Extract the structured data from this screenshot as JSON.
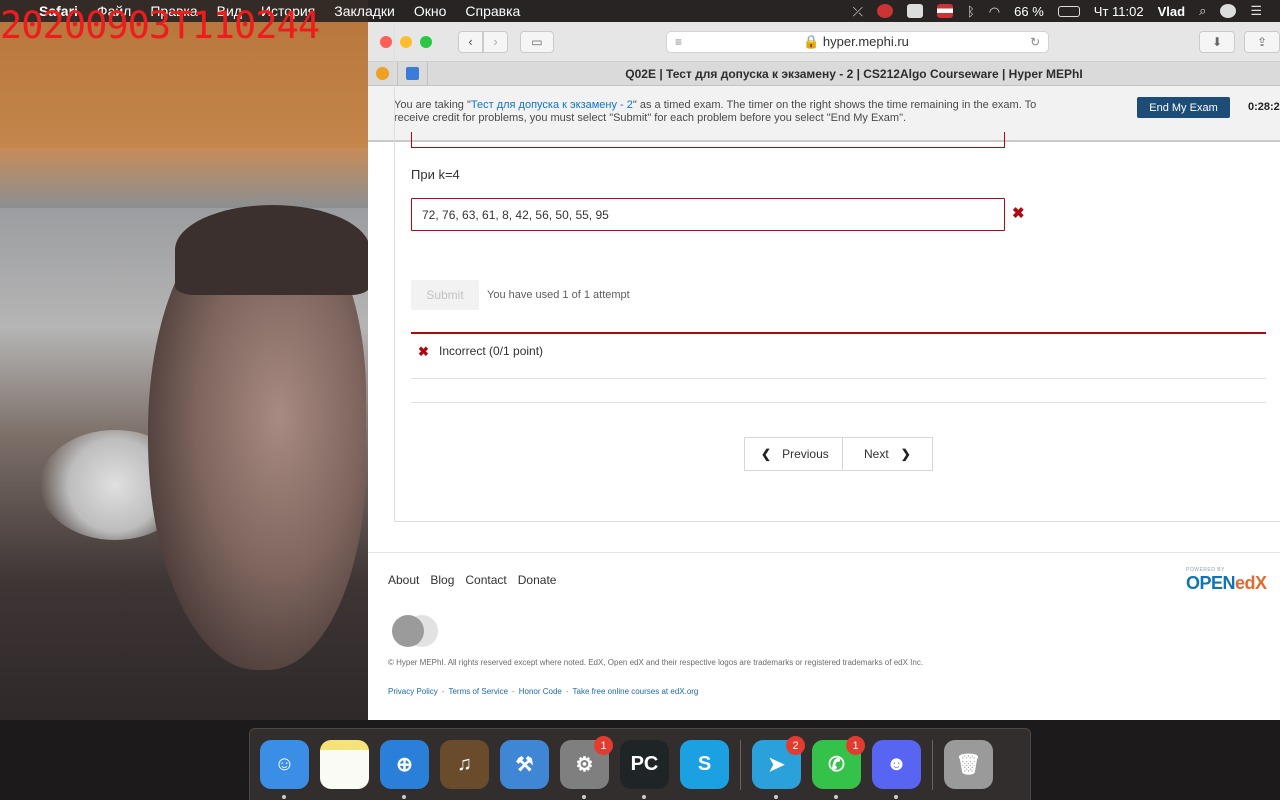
{
  "menubar": {
    "app": "Safari",
    "items": [
      "Файл",
      "Правка",
      "Вид",
      "История",
      "Закладки",
      "Окно",
      "Справка"
    ],
    "battery": "66 %",
    "clock": "Чт 11:02",
    "user": "Vlad"
  },
  "webcam": {
    "timestamp": "20200903T110244"
  },
  "browser": {
    "url": "hyper.mephi.ru",
    "tab_title": "Q02E | Тест для допуска к экзамену - 2 | CS212Algo Courseware | Hyper MEPhI"
  },
  "exam_banner": {
    "msg_before": "You are taking \"",
    "exam_link": "Тест для допуска к экзамену - 2",
    "msg_after": "\" as a timed exam. The timer on the right shows the time remaining in the exam. To receive credit for problems, you must select \"Submit\" for each problem before you select \"End My Exam\".",
    "end_button": "End My Exam",
    "timer": "0:28:2"
  },
  "problem": {
    "k_label": "При k=4",
    "answer_value": "72, 76, 63, 61, 8, 42, 56, 50, 55, 95",
    "submit_label": "Submit",
    "attempts_text": "You have used 1 of 1 attempt",
    "feedback_text": "Incorrect (0/1 point)"
  },
  "pager": {
    "previous": "Previous",
    "next": "Next"
  },
  "footer": {
    "links": [
      "About",
      "Blog",
      "Contact",
      "Donate"
    ],
    "openedx_powered": "POWERED BY",
    "openedx_brand_open": "OPEN",
    "openedx_brand_edx": "edX",
    "copyright": "© Hyper MEPhI. All rights reserved except where noted. EdX, Open edX and their respective logos are trademarks or registered trademarks of edX Inc.",
    "legal_links": [
      "Privacy Policy",
      "Terms of Service",
      "Honor Code",
      "Take free online courses at edX.org"
    ]
  },
  "dock": {
    "items": [
      {
        "name": "finder",
        "color": "#3a8ee6",
        "glyph": "☺",
        "badge": ""
      },
      {
        "name": "notes",
        "color": "#f6e27a",
        "glyph": "",
        "badge": ""
      },
      {
        "name": "safari",
        "color": "#2a7fd8",
        "glyph": "⊕",
        "badge": ""
      },
      {
        "name": "garageband",
        "color": "#6a4b2c",
        "glyph": "♫",
        "badge": ""
      },
      {
        "name": "xcode",
        "color": "#3f86d4",
        "glyph": "⚒",
        "badge": ""
      },
      {
        "name": "system-preferences",
        "color": "#7f7f7f",
        "glyph": "⚙",
        "badge": "1"
      },
      {
        "name": "pycharm",
        "color": "#1f2427",
        "glyph": "PC",
        "badge": ""
      },
      {
        "name": "skype",
        "color": "#1ba0e2",
        "glyph": "S",
        "badge": ""
      },
      {
        "name": "telegram",
        "color": "#2aa1da",
        "glyph": "➤",
        "badge": "2"
      },
      {
        "name": "facetime",
        "color": "#35c24a",
        "glyph": "✆",
        "badge": "1"
      },
      {
        "name": "discord",
        "color": "#5865f2",
        "glyph": "☻",
        "badge": ""
      },
      {
        "name": "trash",
        "color": "#9a9a9a",
        "glyph": "🗑",
        "badge": ""
      }
    ]
  }
}
